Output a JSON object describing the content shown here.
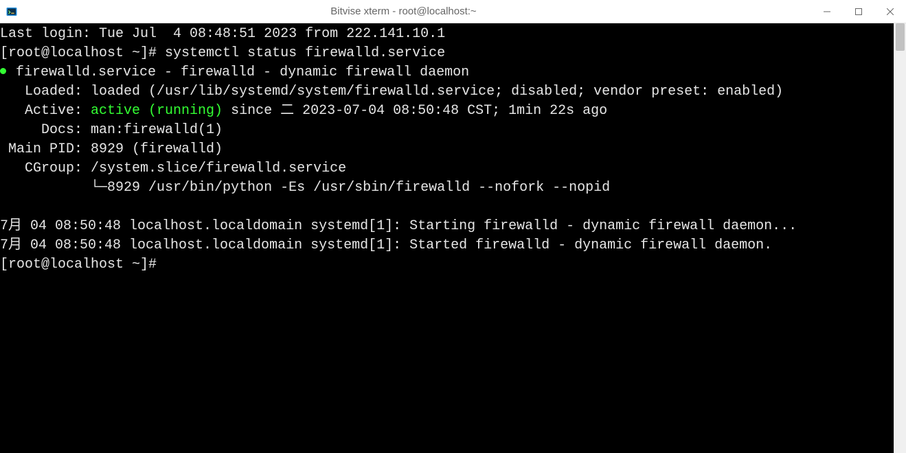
{
  "window": {
    "title": "Bitvise xterm - root@localhost:~"
  },
  "terminal": {
    "last_login": "Last login: Tue Jul  4 08:48:51 2023 from 222.141.10.1",
    "prompt1": "[root@localhost ~]# ",
    "cmd1": "systemctl status firewalld.service",
    "unit_line": " firewalld.service - firewalld - dynamic firewall daemon",
    "loaded": "   Loaded: loaded (/usr/lib/systemd/system/firewalld.service; disabled; vendor preset: enabled)",
    "active_label": "   Active: ",
    "active_value": "active (running)",
    "active_rest": " since 二 2023-07-04 08:50:48 CST; 1min 22s ago",
    "docs": "     Docs: man:firewalld(1)",
    "main_pid": " Main PID: 8929 (firewalld)",
    "cgroup": "   CGroup: /system.slice/firewalld.service",
    "cgroup_child": "           └─8929 /usr/bin/python -Es /usr/sbin/firewalld --nofork --nopid",
    "blank": "",
    "log1": "7月 04 08:50:48 localhost.localdomain systemd[1]: Starting firewalld - dynamic firewall daemon...",
    "log2": "7月 04 08:50:48 localhost.localdomain systemd[1]: Started firewalld - dynamic firewall daemon.",
    "prompt2": "[root@localhost ~]#"
  }
}
